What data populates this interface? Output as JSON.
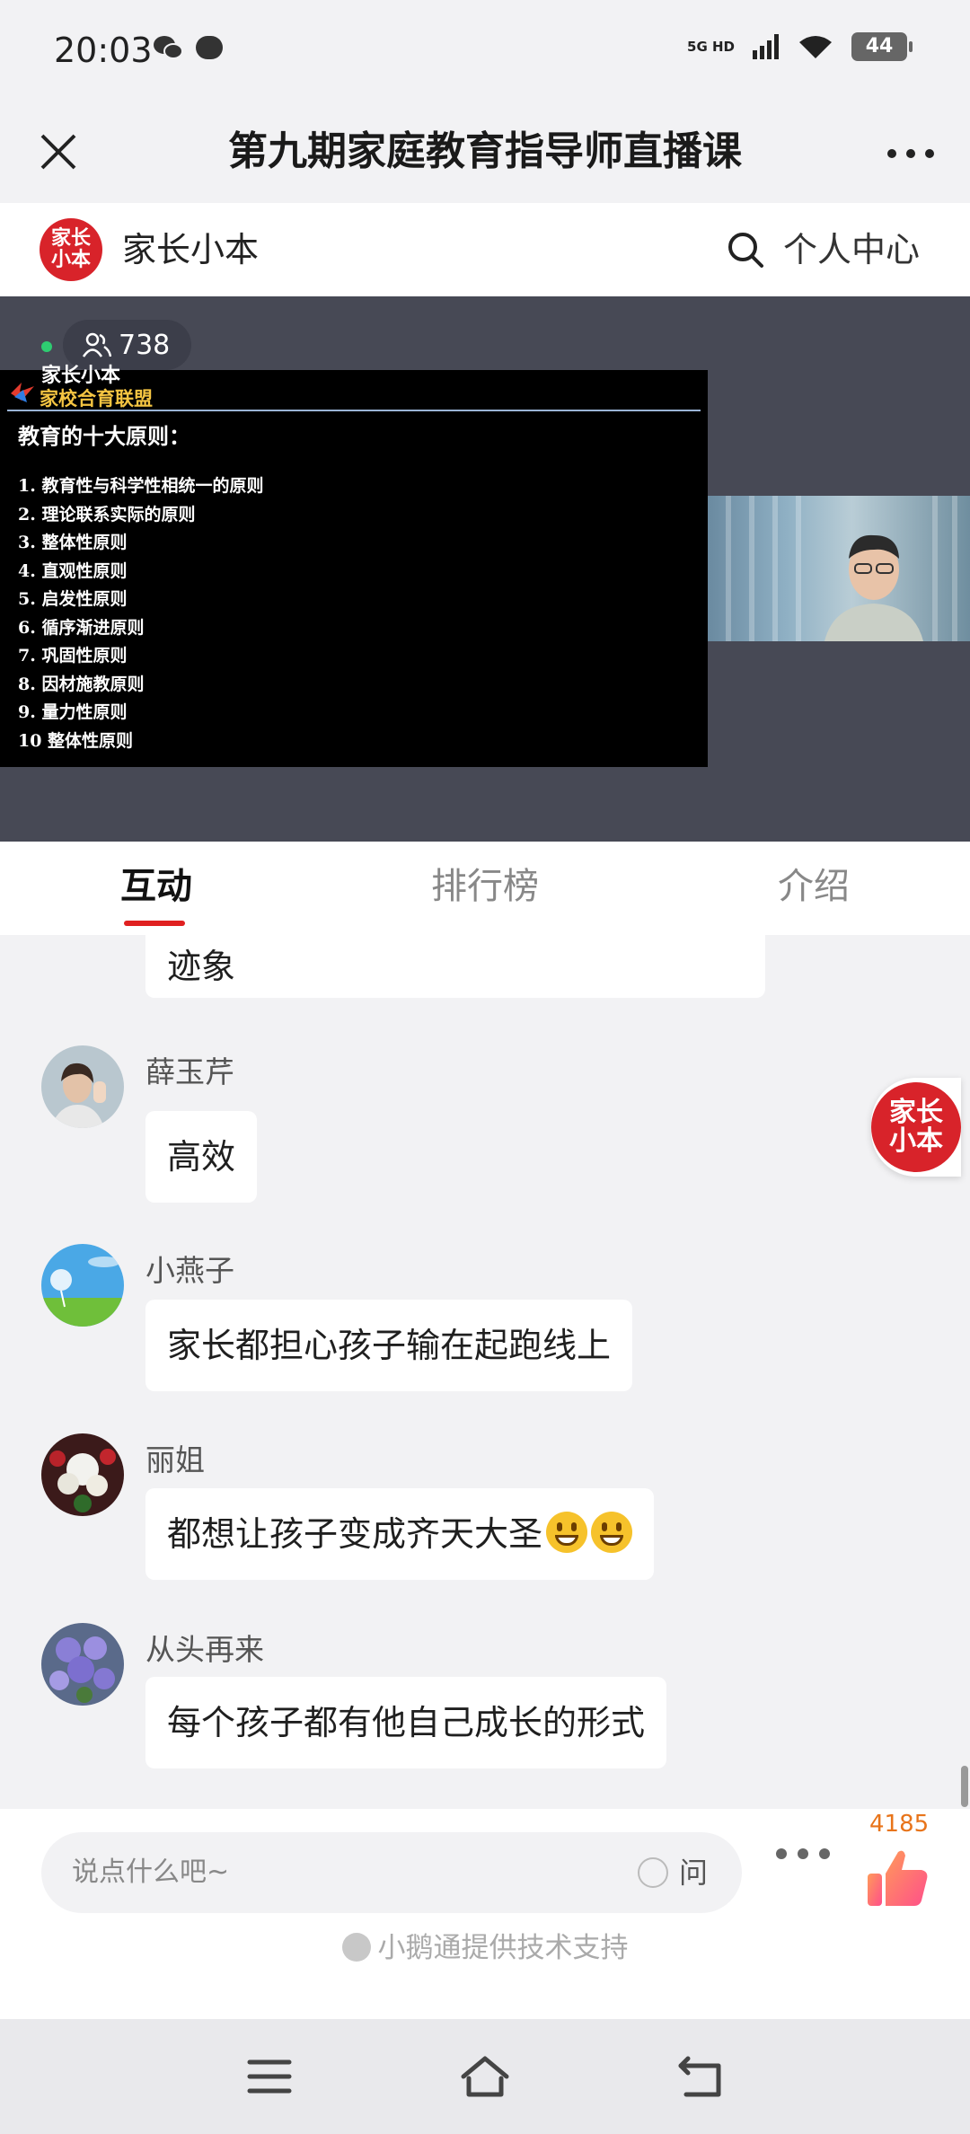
{
  "status_bar": {
    "time": "20:03",
    "network": "5G HD",
    "battery": "44",
    "icons": [
      "wechat-icon",
      "message-icon",
      "signal-icon",
      "wifi-icon",
      "battery-icon"
    ]
  },
  "title_bar": {
    "title": "第九期家庭教育指导师直播课",
    "close_icon": "close-icon",
    "more_icon": "more-icon"
  },
  "brand": {
    "logo_text": "家长小本",
    "name": "家长小本",
    "personal_center": "个人中心"
  },
  "live": {
    "viewer_count": "738",
    "slide": {
      "brand": "家长小本",
      "org": "家校合育联盟",
      "heading": "教育的十大原则：",
      "items": [
        "1. 教育性与科学性相统一的原则",
        "2. 理论联系实际的原则",
        "3. 整体性原则",
        "4. 直观性原则",
        "5. 启发性原则",
        "6. 循序渐进原则",
        "7. 巩固性原则",
        "8. 因材施教原则",
        "9. 量力性原则",
        "10  整体性原则"
      ]
    }
  },
  "tabs": [
    {
      "label": "互动",
      "active": true
    },
    {
      "label": "排行榜",
      "active": false
    },
    {
      "label": "介绍",
      "active": false
    }
  ],
  "chat": {
    "partial_message": "迹象",
    "messages": [
      {
        "name": "薛玉芹",
        "text": "高效"
      },
      {
        "name": "小燕子",
        "text": "家长都担心孩子输在起跑线上"
      },
      {
        "name": "丽姐",
        "text": "都想让孩子变成齐天大圣",
        "emoji_count": 2
      },
      {
        "name": "从头再来",
        "text": "每个孩子都有他自己成长的形式"
      }
    ]
  },
  "floating_logo_text": "家长小本",
  "input": {
    "placeholder": "说点什么吧~",
    "ask_label": "问",
    "like_count": "4185",
    "powered_by": "小鹅通提供技术支持"
  },
  "colors": {
    "accent_red": "#e02020",
    "brand_red": "#d8232a",
    "like_orange": "#e8741a",
    "live_bg": "#474955"
  }
}
